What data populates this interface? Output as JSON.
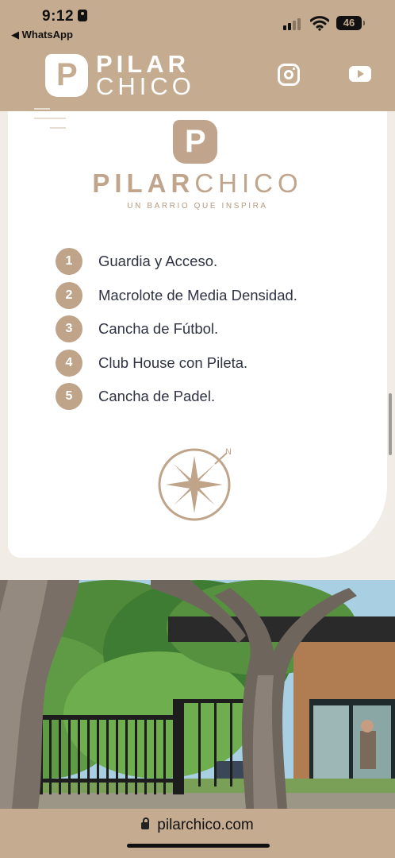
{
  "status_bar": {
    "time": "9:12",
    "back_app": "◀ WhatsApp",
    "battery": "46"
  },
  "header": {
    "logo_line1": "PILAR",
    "logo_line2": "CHICO",
    "icons": [
      "instagram-icon",
      "youtube-icon"
    ]
  },
  "brand": {
    "name_bold": "PILAR",
    "name_light": "CHICO",
    "tagline": "UN BARRIO QUE INSPIRA"
  },
  "legend": [
    {
      "num": "1",
      "label": "Guardia y Acceso."
    },
    {
      "num": "2",
      "label": "Macrolote de Media Densidad."
    },
    {
      "num": "3",
      "label": "Cancha de Fútbol."
    },
    {
      "num": "4",
      "label": "Club House con Pileta."
    },
    {
      "num": "5",
      "label": "Cancha de Padel."
    }
  ],
  "compass": {
    "north_label": "N"
  },
  "url_bar": {
    "url": "pilarchico.com"
  },
  "colors": {
    "brand_tan": "#c5ab8f",
    "accent": "#bfa48a",
    "text": "#2f3343"
  }
}
